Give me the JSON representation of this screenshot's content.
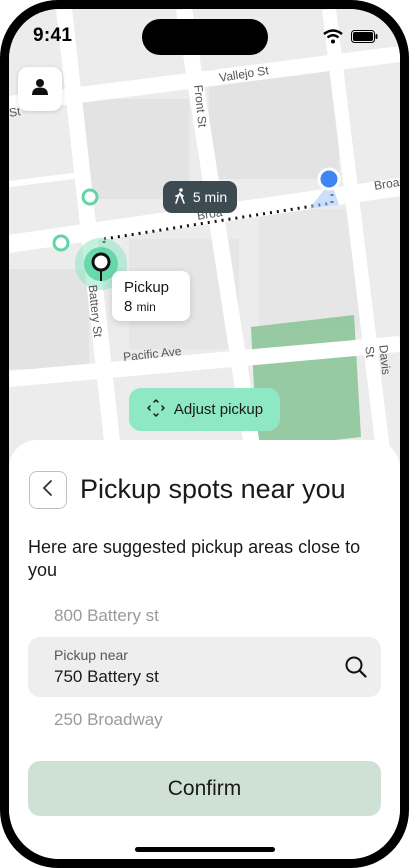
{
  "status": {
    "time": "9:41"
  },
  "map": {
    "streets": {
      "vallejo": "Vallejo St",
      "front": "Front St",
      "broadway_short": "Broa",
      "broadway_mid": "Broa",
      "battery": "Battery St",
      "pacific": "Pacific Ave",
      "davis": "Davis St",
      "edge_st": "St"
    },
    "walk_chip": {
      "label": "5 min",
      "icon": "walk-icon"
    },
    "pickup_card": {
      "title": "Pickup",
      "value": "8",
      "unit": "min"
    },
    "adjust_button": {
      "label": "Adjust pickup",
      "icon": "adjust-target-icon"
    },
    "colors": {
      "accent": "#8ee8c4",
      "pin": "#3e86f5",
      "park": "#7bbf8a"
    }
  },
  "sheet": {
    "title": "Pickup spots near you",
    "description": "Here are suggested pickup areas close to you",
    "options_above": "800 Battery st",
    "field": {
      "label": "Pickup near",
      "value": "750 Battery st"
    },
    "options_below": "250 Broadway",
    "confirm_label": "Confirm"
  }
}
